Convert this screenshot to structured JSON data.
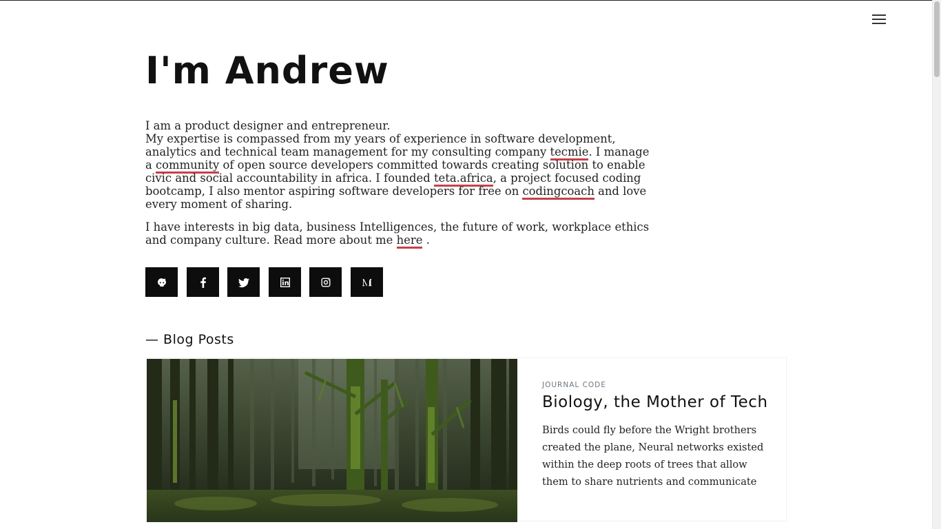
{
  "header": {
    "menu_icon": "hamburger-menu-icon"
  },
  "hero": {
    "title": "I'm Andrew"
  },
  "bio": {
    "line1": "I am a product designer and entrepreneur.",
    "p1_text_a": "My expertise is compassed from my years of experience in software development, analytics and technical team management for my consulting company ",
    "link_tecmie": "tecmie",
    "p1_text_b": ". I manage a ",
    "link_community": "community",
    "p1_text_c": " of open source developers committed towards creating solution to enable civic and social accountability in africa. I founded ",
    "link_teta": "teta.africa",
    "p1_text_d": ", a project focused coding bootcamp, I also mentor aspiring software developers for free on ",
    "link_codingcoach": "codingcoach",
    "p1_text_e": " and love every moment of sharing.",
    "p2_text_a": "I have interests in big data, business Intelligences, the future of work, workplace ethics and company culture. Read more about me ",
    "link_here": "here",
    "p2_text_b": " ."
  },
  "socials": [
    {
      "name": "github",
      "icon": "github-icon"
    },
    {
      "name": "facebook",
      "icon": "facebook-icon"
    },
    {
      "name": "twitter",
      "icon": "twitter-icon"
    },
    {
      "name": "linkedin",
      "icon": "linkedin-icon"
    },
    {
      "name": "instagram",
      "icon": "instagram-icon"
    },
    {
      "name": "medium",
      "icon": "medium-icon"
    }
  ],
  "blog": {
    "section_title": "— Blog Posts",
    "posts": [
      {
        "category": "JOURNAL CODE",
        "title": "Biology, the Mother of Tech",
        "excerpt": "Birds could fly before the Wright brothers created the plane, Neural networks existed within the deep roots of trees that allow them to share nutrients and communicate",
        "image": "forest-photo"
      }
    ]
  },
  "colors": {
    "link_underline": "#c6404a",
    "social_bg": "#0d0d0d",
    "category_text": "#6b7782"
  }
}
